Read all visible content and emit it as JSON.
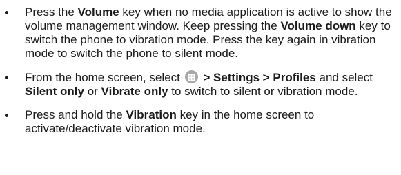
{
  "bullets": [
    {
      "t1": "Press the ",
      "b1": "Volume",
      "t2": " key when no media application is active to show the volume management window. Keep pressing the ",
      "b2": "Volume down",
      "t3": " key to switch the phone to vibration mode. Press the key again in vibration mode to switch the phone to silent mode."
    },
    {
      "t1": "From the home screen, select ",
      "icon": "apps-grid-icon",
      "b1": " > Settings > Profiles",
      "t2": " and select ",
      "b2": "Silent only",
      "t3": " or ",
      "b3": "Vibrate only",
      "t4": " to switch to silent or vibration mode."
    },
    {
      "t1": "Press and hold the ",
      "b1": "Vibration",
      "t2": " key in the home screen to activate/deactivate vibration mode."
    }
  ]
}
